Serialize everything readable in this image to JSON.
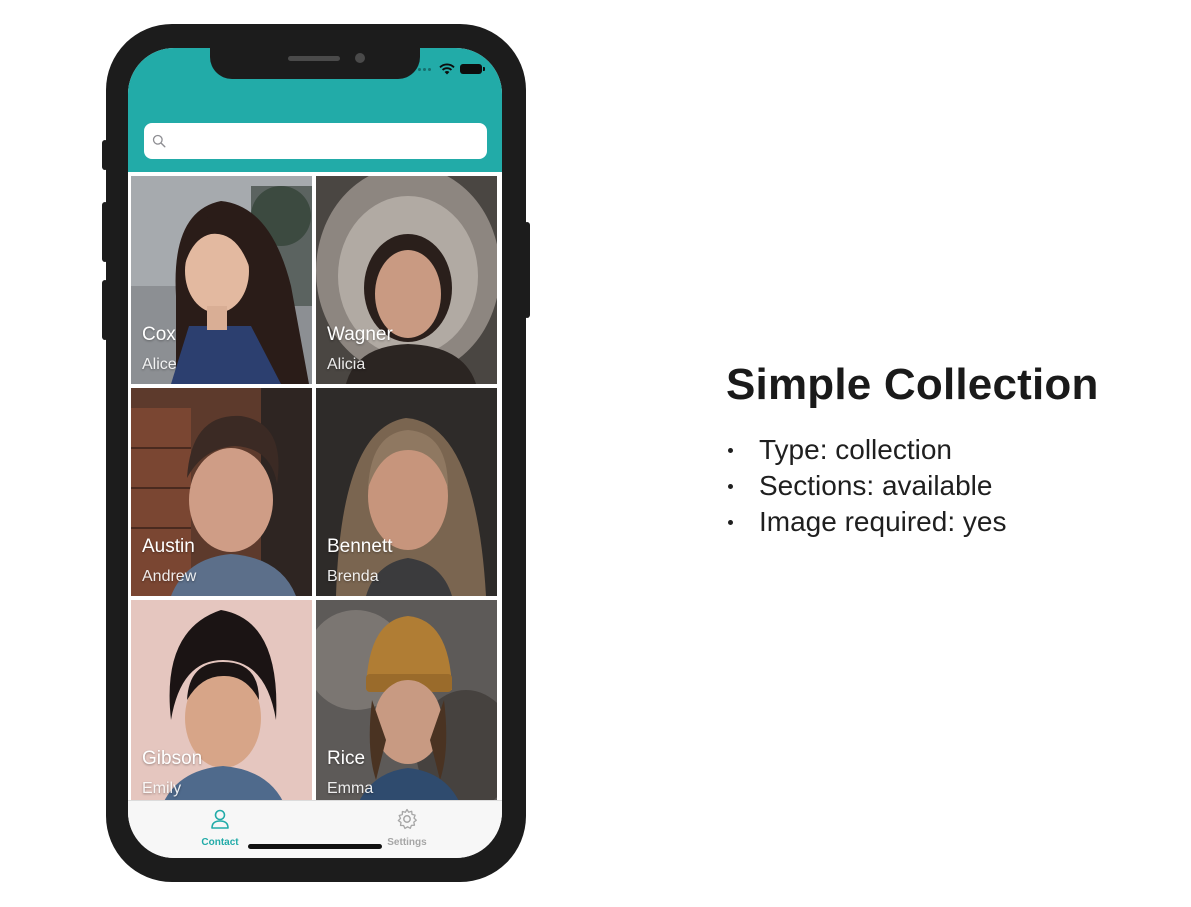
{
  "colors": {
    "accent": "#22aba8",
    "frame": "#1c1c1c",
    "tab_inactive": "#a6a6a6"
  },
  "search": {
    "placeholder": "",
    "icon": "search-icon"
  },
  "contacts": [
    {
      "last_name": "Cox",
      "first_name": "Alice"
    },
    {
      "last_name": "Wagner",
      "first_name": "Alicia"
    },
    {
      "last_name": "Austin",
      "first_name": "Andrew"
    },
    {
      "last_name": "Bennett",
      "first_name": "Brenda"
    },
    {
      "last_name": "Gibson",
      "first_name": "Emily"
    },
    {
      "last_name": "Rice",
      "first_name": "Emma"
    }
  ],
  "tabbar": {
    "tabs": [
      {
        "label": "Contact",
        "icon": "person-icon",
        "selected": true
      },
      {
        "label": "Settings",
        "icon": "gear-icon",
        "selected": false
      }
    ]
  },
  "info": {
    "title": "Simple Collection",
    "bullets": [
      "Type: collection",
      "Sections: available",
      "Image required: yes"
    ]
  }
}
